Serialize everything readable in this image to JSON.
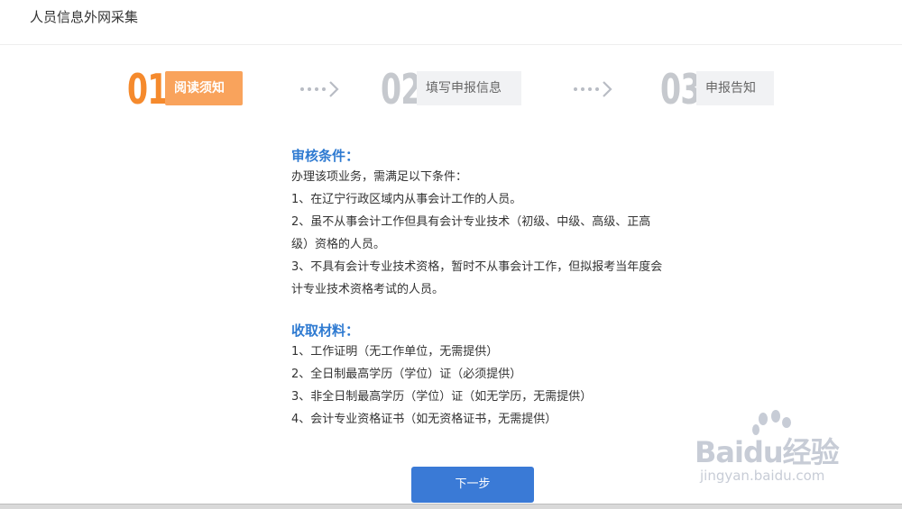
{
  "header": {
    "title": "人员信息外网采集"
  },
  "steps": [
    {
      "num": "01",
      "label": "阅读须知",
      "active": true
    },
    {
      "num": "02",
      "label": "填写申报信息",
      "active": false
    },
    {
      "num": "03",
      "label": "申报告知",
      "active": false
    }
  ],
  "conditions": {
    "title": "审核条件：",
    "lines": [
      "办理该项业务，需满足以下条件：",
      "1、在辽宁行政区域内从事会计工作的人员。",
      "2、虽不从事会计工作但具有会计专业技术（初级、中级、高级、正高",
      "级）资格的人员。",
      "3、不具有会计专业技术资格，暂时不从事会计工作，但拟报考当年度会",
      "计专业技术资格考试的人员。"
    ]
  },
  "materials": {
    "title": "收取材料：",
    "lines": [
      "1、工作证明（无工作单位，无需提供）",
      "2、全日制最高学历（学位）证（必须提供）",
      "3、非全日制最高学历（学位）证（如无学历，无需提供）",
      "4、会计专业资格证书（如无资格证书，无需提供）"
    ]
  },
  "buttons": {
    "next": "下一步"
  },
  "watermark": {
    "brand": "Baidu经验",
    "url": "jingyan.baidu.com"
  },
  "colors": {
    "accent_orange": "#f58a2d",
    "accent_blue": "#2e7ad1",
    "button_blue": "#3a7ad6"
  }
}
